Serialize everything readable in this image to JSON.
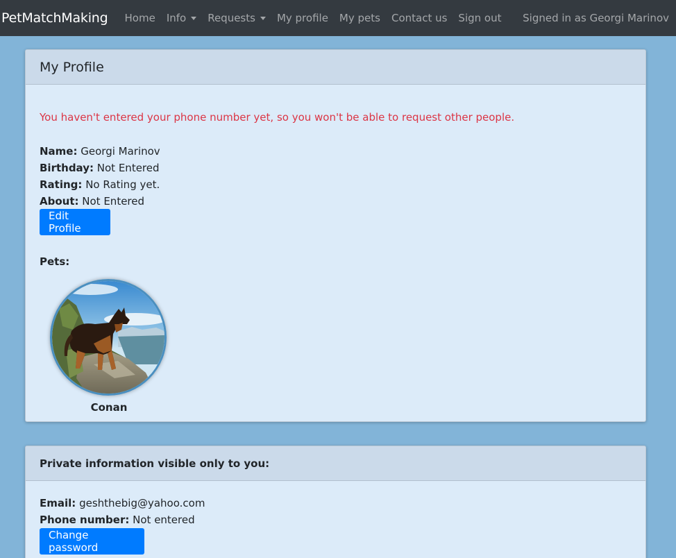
{
  "navbar": {
    "brand": "PetMatchMaking",
    "items": [
      {
        "label": "Home"
      },
      {
        "label": "Info"
      },
      {
        "label": "Requests"
      },
      {
        "label": "My profile"
      },
      {
        "label": "My pets"
      },
      {
        "label": "Contact us"
      },
      {
        "label": "Sign out"
      }
    ],
    "signed_in": "Signed in as Georgi Marinov"
  },
  "profile": {
    "title": "My Profile",
    "warning": "You haven't entered your phone number yet, so you won't be able to request other people.",
    "name_label": "Name:",
    "name_value": "Georgi Marinov",
    "birthday_label": "Birthday:",
    "birthday_value": "Not Entered",
    "rating_label": "Rating:",
    "rating_value": "No Rating yet.",
    "about_label": "About:",
    "about_value": "Not Entered",
    "edit_button": "Edit Profile",
    "pets_label": "Pets:",
    "pets": [
      {
        "name": "Conan"
      }
    ]
  },
  "private": {
    "title": "Private information visible only to you:",
    "email_label": "Email:",
    "email_value": "geshthebig@yahoo.com",
    "phone_label": "Phone number:",
    "phone_value": "Not entered",
    "change_password_button": "Change password"
  },
  "colors": {
    "page_background": "#82b4d8",
    "navbar": "#343a40",
    "card_body": "#dcebf9",
    "card_header": "#cbdaea",
    "primary_button": "#007bff",
    "warning_text": "#dc3545"
  }
}
